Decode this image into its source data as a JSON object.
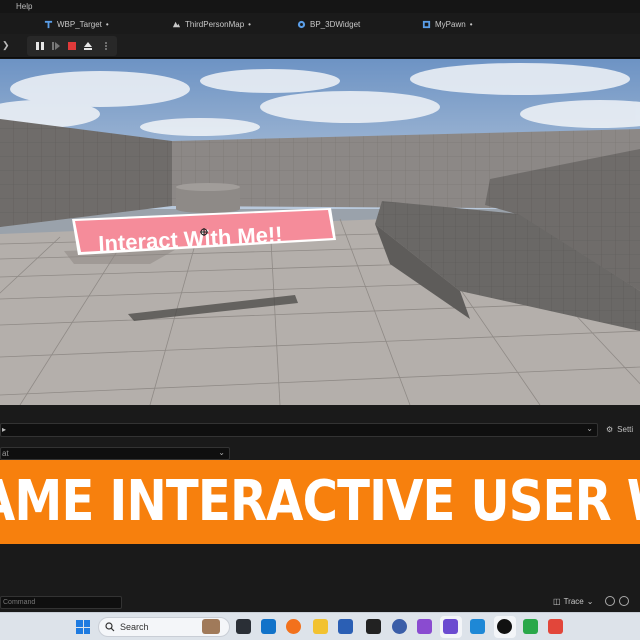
{
  "menubar": {
    "help_label": "Help"
  },
  "tabs": [
    {
      "label": "WBP_Target",
      "icon": "widget-blueprint-icon",
      "color": "#5a9ee8"
    },
    {
      "label": "ThirdPersonMap",
      "icon": "level-map-icon",
      "color": "#c9c9c9"
    },
    {
      "label": "BP_3DWidget",
      "icon": "blueprint-actor-icon",
      "color": "#5a9ee8"
    },
    {
      "label": "MyPawn",
      "icon": "pawn-blueprint-icon",
      "color": "#5a9ee8"
    }
  ],
  "toolbar": {
    "controls": [
      "pause-icon",
      "skip-frame-icon",
      "stop-icon",
      "eject-icon",
      "more-options-icon"
    ],
    "stop_color": "#e03a3a"
  },
  "viewport": {
    "widget_text": "Interact With Me!!",
    "widget_color": "#f58c9a"
  },
  "lower_panel": {
    "settings_label": "Setti"
  },
  "banner": {
    "text": "AME INTERACTIVE USER W",
    "color": "#f7800d"
  },
  "cmdbar": {
    "command_placeholder": "Command",
    "trace_label": "Trace"
  },
  "taskbar": {
    "search_label": "Search",
    "apps": [
      "app-thumbnail-icon",
      "task-view-icon",
      "outlook-icon",
      "firefox-icon",
      "file-explorer-icon",
      "word-icon",
      "epic-games-icon",
      "globe-icon",
      "visual-studio-icon",
      "v-app-icon",
      "vscode-icon",
      "unreal-engine-icon",
      "camtasia-icon",
      "recorder-icon"
    ]
  }
}
